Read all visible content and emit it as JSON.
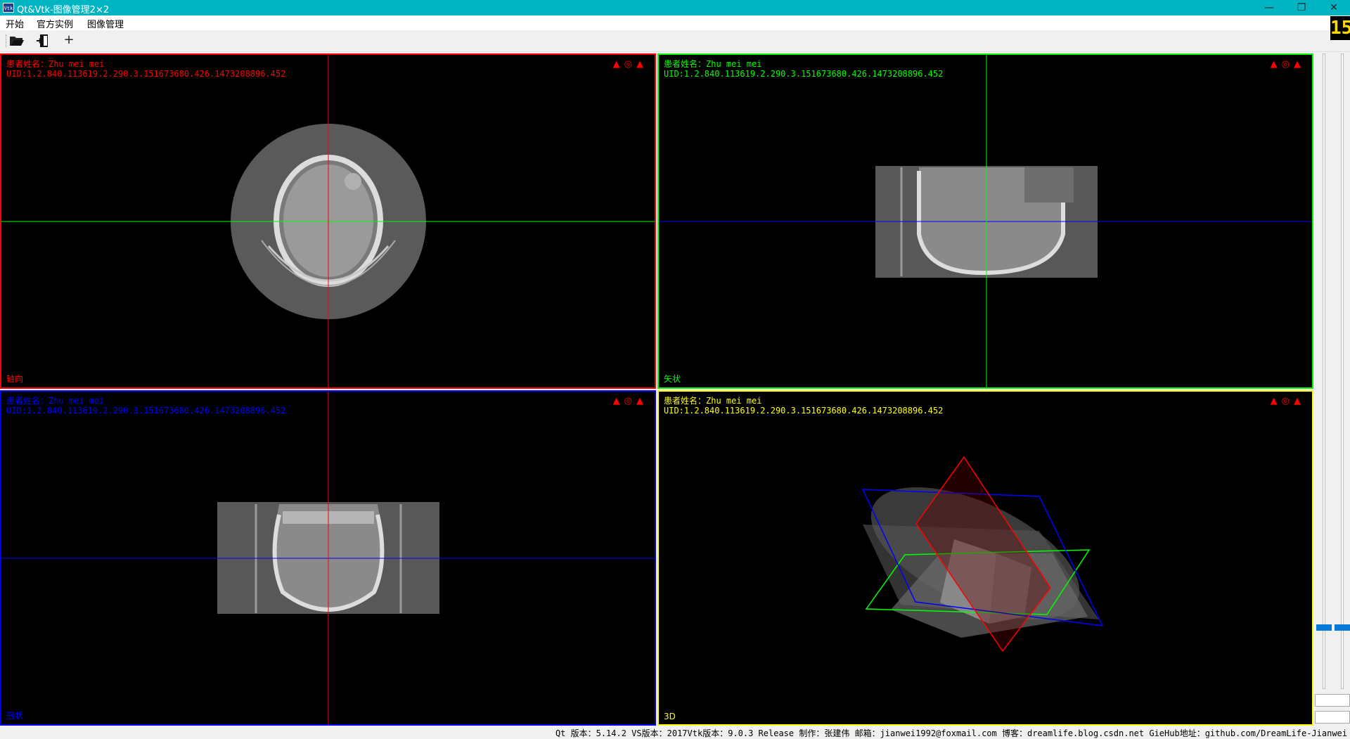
{
  "window": {
    "title": "Qt&Vtk-图像管理2×2",
    "app_icon_text": "Vtk",
    "minimize": "—",
    "restore": "❐",
    "close": "✕"
  },
  "menu": [
    "开始",
    "官方实例",
    "图像管理"
  ],
  "toolbar": {
    "open_icon": "folder-open-icon",
    "exit_icon": "exit-door-icon",
    "add_label": "+",
    "fps": "15"
  },
  "views": [
    {
      "name": "axial",
      "color": "#ff0000",
      "patient": "患者姓名：Zhu mei mei",
      "uid": "UID:1.2.840.113619.2.290.3.151673680.426.1473208896.452",
      "label": "轴向",
      "icons": "▲◎▲"
    },
    {
      "name": "sagittal",
      "color": "#00ff00",
      "patient": "患者姓名：Zhu mei mei",
      "uid": "UID:1.2.840.113619.2.290.3.151673680.426.1473208896.452",
      "label": "矢状",
      "icons": "▲◎▲"
    },
    {
      "name": "coronal",
      "color": "#0000ff",
      "patient": "患者姓名：Zhu mei mei",
      "uid": "UID:1.2.840.113619.2.290.3.151673680.426.1473208896.452",
      "label": "冠状",
      "icons": "▲◎▲"
    },
    {
      "name": "3d",
      "color": "#ffff00",
      "patient": "患者姓名：Zhu mei mei",
      "uid": "UID:1.2.840.113619.2.290.3.151673680.426.1473208896.452",
      "label": "3D",
      "icons": "▲◎▲"
    }
  ],
  "status": "Qt 版本：5.14.2  VS版本：2017Vtk版本：9.0.3 Release 制作：张建伟 邮箱：jianwei1992@foxmail.com 博客：dreamlife.blog.csdn.net GieHub地址：github.com/DreamLife-Jianwei"
}
